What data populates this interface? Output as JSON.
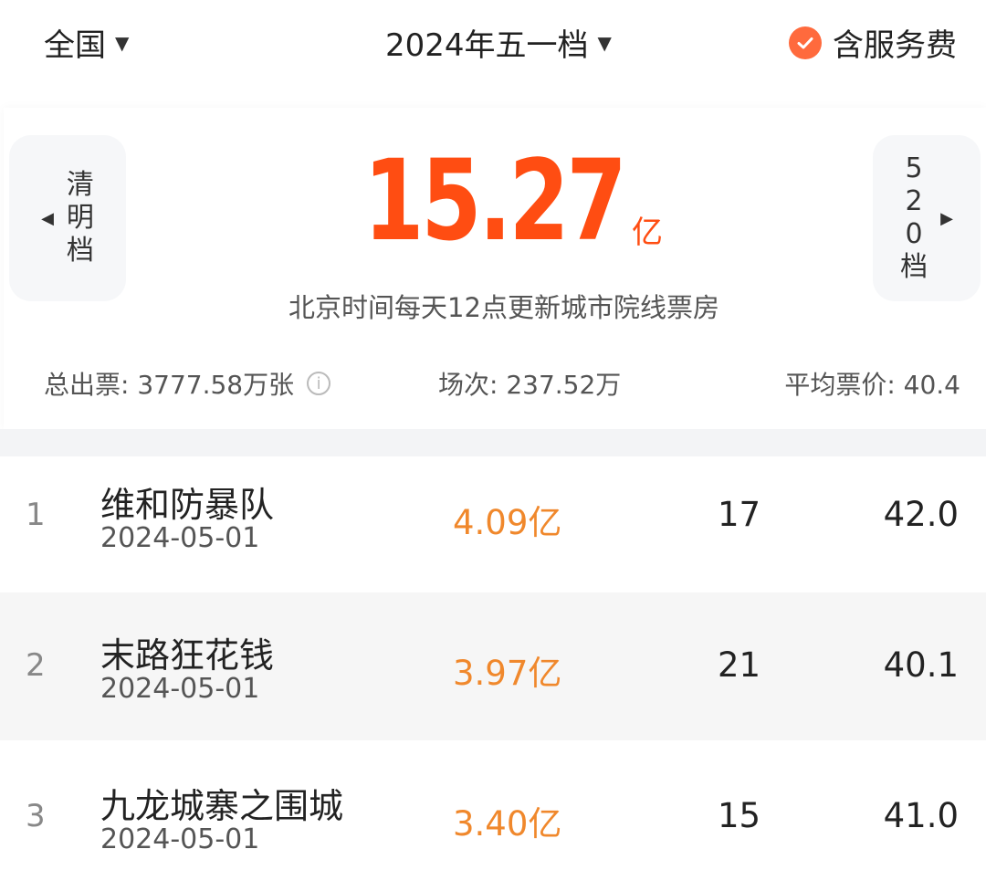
{
  "top_bar": {
    "region": "全国",
    "period": "2024年五一档",
    "service_fee_label": "含服务费",
    "service_fee_checked": true
  },
  "summary": {
    "prev_period": [
      "清",
      "明",
      "档"
    ],
    "next_period": [
      "5",
      "2",
      "0",
      "档"
    ],
    "total_amount": "15.27",
    "total_unit": "亿",
    "update_note": "北京时间每天12点更新城市院线票房",
    "tickets": "总出票: 3777.58万张",
    "shows": "场次: 237.52万",
    "avg_price": "平均票价: 40.4"
  },
  "movies": [
    {
      "rank": "1",
      "title": "维和防暴队",
      "date": "2024-05-01",
      "box_office": "4.09亿",
      "share": "17",
      "avg_price": "42.0"
    },
    {
      "rank": "2",
      "title": "末路狂花钱",
      "date": "2024-05-01",
      "box_office": "3.97亿",
      "share": "21",
      "avg_price": "40.1"
    },
    {
      "rank": "3",
      "title": "九龙城寨之围城",
      "date": "2024-05-01",
      "box_office": "3.40亿",
      "share": "15",
      "avg_price": "41.0"
    }
  ],
  "colors": {
    "accent": "#ff4d12",
    "box_office": "#f0882c",
    "check": "#ff6a3d"
  },
  "icons": {
    "region_caret": "caret-down-icon",
    "period_caret": "caret-down-icon",
    "fee_check": "check-circle-icon",
    "prev_arrow": "arrow-left-icon",
    "next_arrow": "arrow-right-icon",
    "tickets_info": "info-icon"
  }
}
